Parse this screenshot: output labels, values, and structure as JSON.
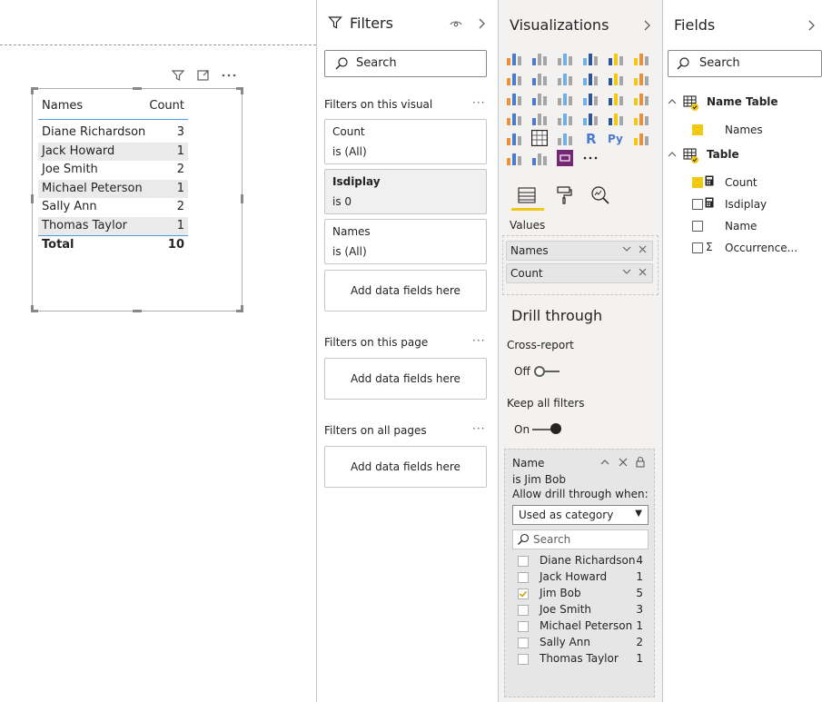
{
  "canvas": {
    "visual_header_icons": [
      "filter-icon",
      "focus-mode-icon",
      "more-options-icon"
    ],
    "table": {
      "headers": {
        "names": "Names",
        "count": "Count"
      },
      "rows": [
        {
          "name": "Diane Richardson",
          "count": "3"
        },
        {
          "name": "Jack Howard",
          "count": "1"
        },
        {
          "name": "Joe Smith",
          "count": "2"
        },
        {
          "name": "Michael Peterson",
          "count": "1"
        },
        {
          "name": "Sally Ann",
          "count": "2"
        },
        {
          "name": "Thomas Taylor",
          "count": "1"
        }
      ],
      "total": {
        "label": "Total",
        "value": "10"
      }
    }
  },
  "filters_pane": {
    "title": "Filters",
    "search_placeholder": "Search",
    "on_visual_label": "Filters on this visual",
    "cards": [
      {
        "title": "Count",
        "state": "is (All)"
      },
      {
        "title": "Isdiplay",
        "state": "is 0"
      },
      {
        "title": "Names",
        "state": "is (All)"
      }
    ],
    "add_fields": "Add data fields here",
    "on_page_label": "Filters on this page",
    "on_all_pages_label": "Filters on all pages"
  },
  "viz_pane": {
    "title": "Visualizations",
    "values_label": "Values",
    "wells": [
      "Names",
      "Count"
    ],
    "drill_through_title": "Drill through",
    "cross_report_label": "Cross-report",
    "cross_report_state": "Off",
    "keep_filters_label": "Keep all filters",
    "keep_filters_state": "On",
    "drill_card": {
      "field": "Name",
      "condition": "is Jim Bob",
      "allow_label": "Allow drill through when:",
      "dropdown_value": "Used as category",
      "search_placeholder": "Search",
      "items": [
        {
          "name": "Diane Richardson",
          "count": "4",
          "checked": false
        },
        {
          "name": "Jack Howard",
          "count": "1",
          "checked": false
        },
        {
          "name": "Jim Bob",
          "count": "5",
          "checked": true
        },
        {
          "name": "Joe Smith",
          "count": "3",
          "checked": false
        },
        {
          "name": "Michael Peterson",
          "count": "1",
          "checked": false
        },
        {
          "name": "Sally Ann",
          "count": "2",
          "checked": false
        },
        {
          "name": "Thomas Taylor",
          "count": "1",
          "checked": false
        }
      ]
    }
  },
  "fields_pane": {
    "title": "Fields",
    "search_placeholder": "Search",
    "tables": [
      {
        "name": "Name Table",
        "fields": [
          {
            "name": "Names",
            "checked": true,
            "icon": "none"
          }
        ]
      },
      {
        "name": "Table",
        "fields": [
          {
            "name": "Count",
            "checked": true,
            "icon": "calculator-icon"
          },
          {
            "name": "Isdiplay",
            "checked": false,
            "icon": "calculator-icon"
          },
          {
            "name": "Name",
            "checked": false,
            "icon": "none"
          },
          {
            "name": "Occurrence...",
            "checked": false,
            "icon": "sigma-icon"
          }
        ]
      }
    ]
  },
  "colors": {
    "accent": "#f2c811",
    "purple": "#742774",
    "table_header_line": "#5b9bd5"
  }
}
